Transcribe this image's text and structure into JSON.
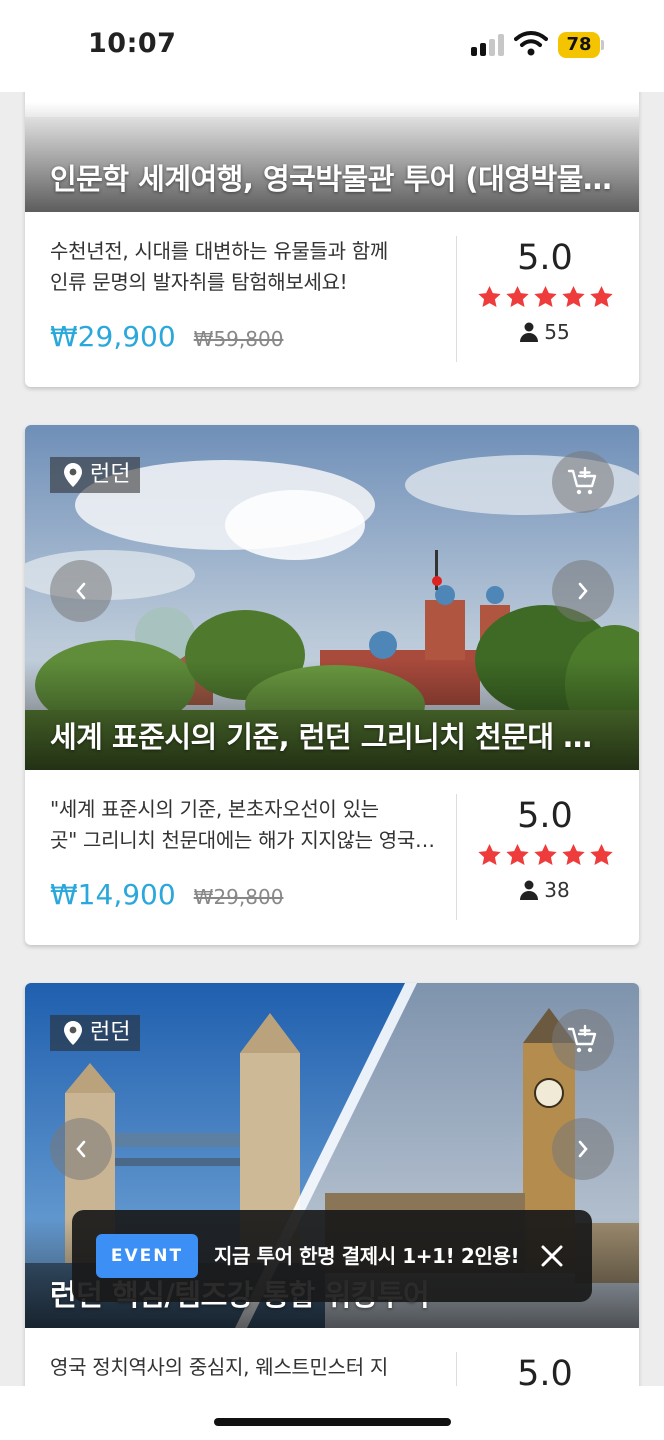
{
  "status_bar": {
    "time": "10:07",
    "battery": "78"
  },
  "colors": {
    "price": "#2aa8db",
    "star": "#ee3b3b",
    "event_tag": "#3b8ff5",
    "battery": "#f5c400"
  },
  "tours": [
    {
      "title": "인문학 세계여행, 영국박물관 투어 (대영박물관 투어)",
      "location": "",
      "description_lines": [
        "수천년전, 시대를 대변하는 유물들과 함께",
        "인류 문명의 발자취를 탐험해보세요!"
      ],
      "price": "₩29,900",
      "original_price": "₩59,800",
      "rating": "5.0",
      "rating_value": 5,
      "review_count": "55"
    },
    {
      "title": "세계 표준시의 기준, 런던 그리니치 천문대 투어",
      "location": "런던",
      "description_lines": [
        "\"세계 표준시의 기준, 본초자오선이 있는",
        "곳\"  그리니치 천문대에는 해가 지지않는 영국의 역사가"
      ],
      "price": "₩14,900",
      "original_price": "₩29,800",
      "rating": "5.0",
      "rating_value": 5,
      "review_count": "38"
    },
    {
      "title": "런던 핵심/템즈강 통합 워킹투어",
      "location": "런던",
      "description_lines": [
        "영국 정치역사의 중심지, 웨스트민스터 지"
      ],
      "rating": "5.0",
      "rating_value": 5
    }
  ],
  "event_banner": {
    "tag": "EVENT",
    "text": "지금 투어 한명 결제시 1+1! 2인용!"
  },
  "icons": {
    "location": "map-pin-icon",
    "cart": "cart-plus-icon",
    "prev": "chevron-left-icon",
    "next": "chevron-right-icon",
    "close": "close-icon",
    "reviewer": "person-icon",
    "star": "star-icon"
  }
}
